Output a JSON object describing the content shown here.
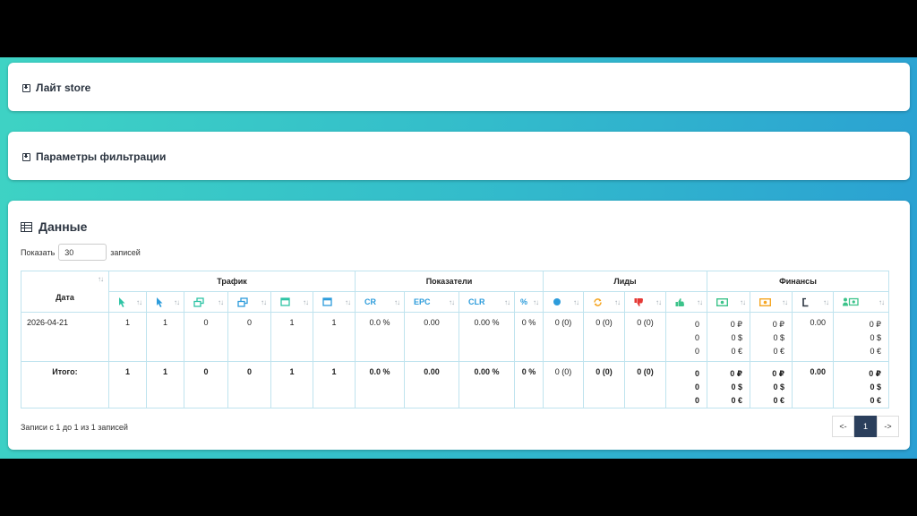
{
  "panels": {
    "lite_store": "Лайт store",
    "filters": "Параметры фильтрации",
    "data": "Данные"
  },
  "length": {
    "show": "Показать",
    "value": "30",
    "records": "записей"
  },
  "table": {
    "date_header": "Дата",
    "groups": [
      "Трафик",
      "Показатели",
      "Лиды",
      "Финансы"
    ],
    "metric_labels": [
      "CR",
      "EPC",
      "CLR",
      "%"
    ],
    "icons": {
      "traffic": [
        "cursor-icon",
        "cursor-icon",
        "windows-icon",
        "windows-icon",
        "window-icon",
        "window-icon"
      ],
      "leads": [
        "circle-icon",
        "refresh-icon",
        "thumbs-down-icon",
        "thumbs-up-icon"
      ],
      "finance": [
        "money-icon",
        "money-icon",
        "hold-icon",
        "user-money-icon"
      ]
    },
    "row": {
      "date": "2026-04-21",
      "traffic": [
        "1",
        "1",
        "0",
        "0",
        "1",
        "1"
      ],
      "cr": "0.0 %",
      "epc": "0.00",
      "clr": "0.00 %",
      "pct": "0 %",
      "leads": [
        "0 (0)",
        "0 (0)",
        "0 (0)"
      ],
      "leads_last": [
        "0",
        "0",
        "0"
      ],
      "fin1": [
        "0 ₽",
        "0 $",
        "0 €"
      ],
      "fin2": [
        "0 ₽",
        "0 $",
        "0 €"
      ],
      "fin3": "0.00",
      "fin4": [
        "0 ₽",
        "0 $",
        "0 €"
      ]
    },
    "total": {
      "label": "Итого:",
      "traffic": [
        "1",
        "1",
        "0",
        "0",
        "1",
        "1"
      ],
      "cr": "0.0 %",
      "epc": "0.00",
      "clr": "0.00 %",
      "pct": "0 %",
      "leads": [
        "0 (0)",
        "0 (0)",
        "0 (0)"
      ],
      "leads_last": [
        "0",
        "0",
        "0"
      ],
      "fin1": [
        "0 ₽",
        "0 $",
        "0 €"
      ],
      "fin2": [
        "0 ₽",
        "0 $",
        "0 €"
      ],
      "fin3": "0.00",
      "fin4": [
        "0 ₽",
        "0 $",
        "0 €"
      ]
    }
  },
  "footer": {
    "info": "Записи с 1 до 1 из 1 записей"
  },
  "pager": {
    "prev": "<-",
    "current": "1",
    "next": "->"
  },
  "colors": {
    "teal": "#2ec4a5",
    "blue": "#2d9cdb",
    "orange": "#f5a623",
    "red": "#e53935",
    "green": "#3cc38a",
    "navy": "#2b3f5c"
  }
}
